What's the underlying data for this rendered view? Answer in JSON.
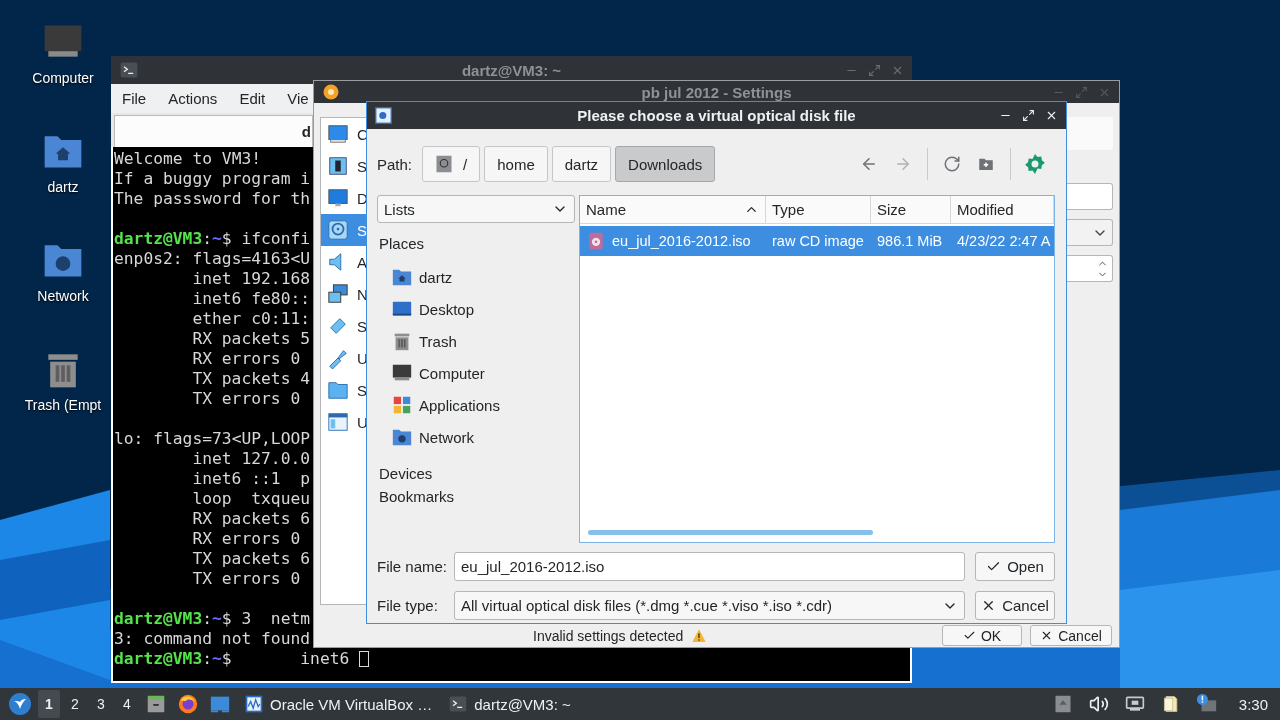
{
  "desktop": {
    "icons": [
      {
        "kind": "computer",
        "label": "Computer"
      },
      {
        "kind": "home-folder",
        "label": "dartz"
      },
      {
        "kind": "network-folder",
        "label": "Network"
      },
      {
        "kind": "trash",
        "label": "Trash (Empt"
      }
    ]
  },
  "terminal": {
    "title": "dartz@VM3: ~",
    "menu": [
      "File",
      "Actions",
      "Edit",
      "Vie"
    ],
    "tab": "d",
    "lines": [
      {
        "kind": "output",
        "text": "Welcome to VM3!"
      },
      {
        "kind": "output",
        "text": "If a buggy program i"
      },
      {
        "kind": "output",
        "text": "The passsword for th"
      },
      {
        "kind": "blank"
      },
      {
        "kind": "prompt",
        "user": "dartz@VM3",
        "sep": ":",
        "path": "~",
        "text": "$ ifconfi"
      },
      {
        "kind": "output",
        "text": "enp0s2: flags=4163<U"
      },
      {
        "kind": "detail",
        "text": "inet 192.168"
      },
      {
        "kind": "detail",
        "text": "inet6 fe80::"
      },
      {
        "kind": "detail",
        "text": "ether c0:11:"
      },
      {
        "kind": "detail",
        "text": "RX packets 5"
      },
      {
        "kind": "detail",
        "text": "RX errors 0"
      },
      {
        "kind": "detail",
        "text": "TX packets 4"
      },
      {
        "kind": "detail",
        "text": "TX errors 0"
      },
      {
        "kind": "blank"
      },
      {
        "kind": "output",
        "text": "lo: flags=73<UP,LOOP"
      },
      {
        "kind": "detail",
        "text": "inet 127.0.0"
      },
      {
        "kind": "detail",
        "text": "inet6 ::1  p"
      },
      {
        "kind": "detail",
        "text": "loop  txqueu"
      },
      {
        "kind": "detail",
        "text": "RX packets 6"
      },
      {
        "kind": "detail",
        "text": "RX errors 0"
      },
      {
        "kind": "detail",
        "text": "TX packets 6"
      },
      {
        "kind": "detail",
        "text": "TX errors 0"
      },
      {
        "kind": "blank"
      },
      {
        "kind": "prompt",
        "user": "dartz@VM3",
        "sep": ":",
        "path": "~",
        "text": "$ 3  netm"
      },
      {
        "kind": "output",
        "text": "3: command not found"
      },
      {
        "kind": "prompt",
        "user": "dartz@VM3",
        "sep": ":",
        "path": "~",
        "text": "$",
        "tail": "inet6"
      }
    ]
  },
  "settings": {
    "title": "pb jul 2012 - Settings",
    "sections": [
      {
        "kind": "general",
        "label": "C",
        "selected": false
      },
      {
        "kind": "system",
        "label": "S",
        "selected": false
      },
      {
        "kind": "display",
        "label": "D",
        "selected": false
      },
      {
        "kind": "storage",
        "label": "S",
        "selected": true
      },
      {
        "kind": "audio",
        "label": "A",
        "selected": false
      },
      {
        "kind": "network",
        "label": "N",
        "selected": false
      },
      {
        "kind": "serial",
        "label": "S",
        "selected": false
      },
      {
        "kind": "usb",
        "label": "U",
        "selected": false
      },
      {
        "kind": "shared",
        "label": "S",
        "selected": false
      },
      {
        "kind": "interface",
        "label": "U",
        "selected": false
      }
    ],
    "controls": [
      {
        "kind": "panel"
      },
      {
        "kind": "field"
      },
      {
        "kind": "dropdown"
      },
      {
        "kind": "spinbox"
      }
    ],
    "status": "Invalid settings detected",
    "buttons": [
      {
        "kind": "ok",
        "label": "OK"
      },
      {
        "kind": "cancel",
        "label": "Cancel"
      }
    ]
  },
  "dialog": {
    "title": "Please choose a virtual optical disk file",
    "path_label": "Path:",
    "path": [
      {
        "kind": "root",
        "label": "/",
        "selected": false
      },
      {
        "kind": "folder",
        "label": "home",
        "selected": false
      },
      {
        "kind": "folder",
        "label": "dartz",
        "selected": false
      },
      {
        "kind": "folder",
        "label": "Downloads",
        "selected": true
      }
    ],
    "tools": [
      {
        "kind": "back",
        "disabled": false
      },
      {
        "kind": "forward",
        "disabled": true
      },
      {
        "kind": "reload"
      },
      {
        "kind": "new-folder"
      },
      {
        "kind": "options"
      }
    ],
    "view": "Lists",
    "groups": [
      {
        "label": "Places",
        "items": [
          {
            "kind": "home-folder",
            "label": "dartz"
          },
          {
            "kind": "desktop",
            "label": "Desktop"
          },
          {
            "kind": "trash",
            "label": "Trash"
          },
          {
            "kind": "computer",
            "label": "Computer"
          },
          {
            "kind": "applications",
            "label": "Applications"
          },
          {
            "kind": "network-folder",
            "label": "Network"
          }
        ]
      },
      {
        "label": "Devices"
      },
      {
        "label": "Bookmarks"
      }
    ],
    "columns": [
      {
        "label": "Name",
        "sorted": true
      },
      {
        "label": "Type",
        "sorted": false
      },
      {
        "label": "Size",
        "sorted": false
      },
      {
        "label": "Modified",
        "sorted": false
      }
    ],
    "rows": [
      {
        "kind": "disc-image",
        "selected": true,
        "cells": [
          "eu_jul_2016-2012.iso",
          "raw CD image",
          "986.1 MiB",
          "4/23/22 2:47 A"
        ]
      }
    ],
    "file_name_label": "File name:",
    "file_name": "eu_jul_2016-2012.iso",
    "file_type_label": "File type:",
    "file_type": "All virtual optical disk files (*.dmg *.cue *.viso *.iso *.cdr)",
    "buttons": [
      {
        "kind": "open",
        "label": "Open"
      },
      {
        "kind": "cancel",
        "label": "Cancel"
      }
    ]
  },
  "taskbar": {
    "workspaces": [
      {
        "label": "1",
        "selected": true
      },
      {
        "label": "2",
        "selected": false
      },
      {
        "label": "3",
        "selected": false
      },
      {
        "label": "4",
        "selected": false
      }
    ],
    "launchers": [
      {
        "kind": "files"
      },
      {
        "kind": "browser"
      },
      {
        "kind": "desktop"
      }
    ],
    "tasks": [
      {
        "kind": "virtualbox",
        "label": "Oracle VM VirtualBox …"
      },
      {
        "kind": "terminal",
        "label": "dartz@VM3: ~"
      }
    ],
    "tray": [
      {
        "kind": "eject"
      },
      {
        "kind": "volume"
      },
      {
        "kind": "network"
      },
      {
        "kind": "clipboard"
      },
      {
        "kind": "notification"
      }
    ],
    "clock": "3:30"
  }
}
